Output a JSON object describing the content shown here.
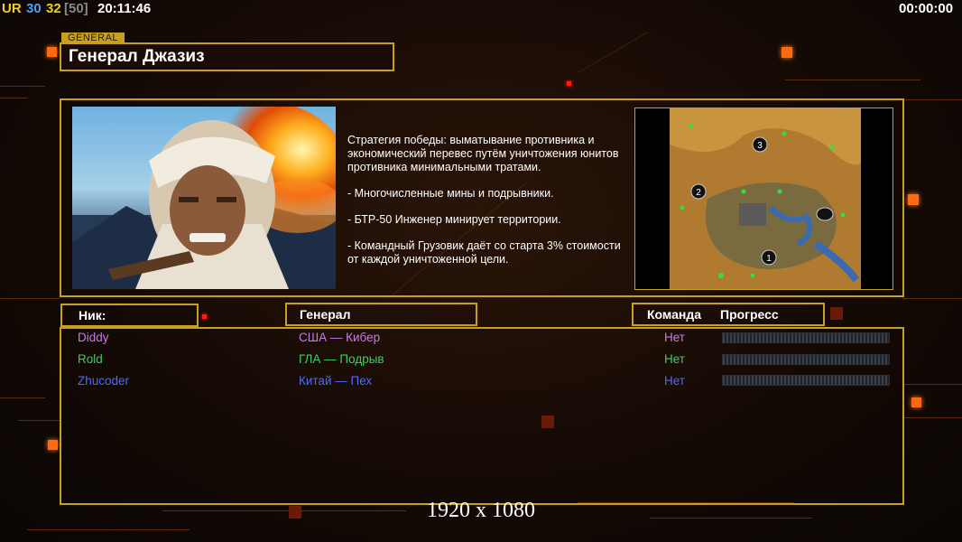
{
  "topbar": {
    "ur": "UR",
    "fps": "30",
    "fps_target": "32",
    "fps_cap": "[50]",
    "clock": "20:11:46",
    "timer": "00:00:00"
  },
  "general": {
    "tag": "GENERAL",
    "name": "Генерал Джазиз",
    "description": [
      "Стратегия победы: выматывание противника и экономический перевес путём уничтожения юнитов противника минимальными тратами.",
      "- Многочисленные мины и подрывники.",
      "- БТР-50 Инженер минирует территории.",
      "- Командный Грузовик даёт со старта 3% стоимости от каждой уничтоженной цели."
    ]
  },
  "map": {
    "start_positions": [
      "1",
      "2",
      "3"
    ]
  },
  "table": {
    "headers": {
      "nick": "Ник:",
      "general": "Генерал",
      "team": "Команда",
      "progress": "Прогресс"
    },
    "rows": [
      {
        "nick": "Diddy",
        "general": "США — Кибер",
        "team": "Нет",
        "color": "#c87ae8",
        "progress": 0
      },
      {
        "nick": "Rold",
        "general": "ГЛА — Подрыв",
        "team": "Нет",
        "color": "#39d062",
        "progress": 0
      },
      {
        "nick": "Zhucoder",
        "general": "Китай — Пех",
        "team": "Нет",
        "color": "#4a6cff",
        "progress": 0
      }
    ]
  },
  "resolution": "1920 x 1080",
  "colors": {
    "accent": "#c8a020",
    "ur": "#f0d020",
    "fps": "#4aa0ff",
    "fps_target": "#f0d020",
    "fps_cap": "#888888"
  }
}
